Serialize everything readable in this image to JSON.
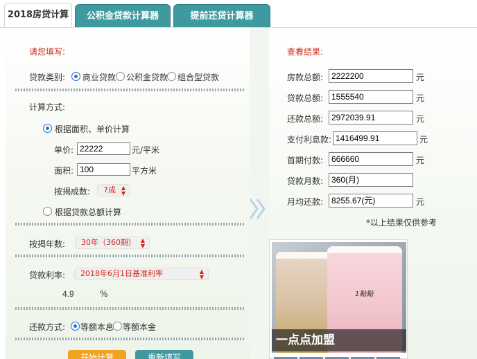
{
  "tabs": [
    "2018房贷计算器",
    "公积金贷款计算器",
    "提前还贷计算器"
  ],
  "form": {
    "header": "请您填写:",
    "loan_type_label": "贷款类别:",
    "loan_types": [
      "商业贷款",
      "公积金贷款",
      "组合型贷款"
    ],
    "calc_method_label": "计算方式:",
    "method_area": "根据面积、单价计算",
    "price_label": "单价:",
    "price_value": "22222",
    "price_unit": "元/平米",
    "area_label": "面积:",
    "area_value": "100",
    "area_unit": "平方米",
    "ratio_label": "按揭成数:",
    "ratio_value": "7成",
    "method_total": "根据贷款总额计算",
    "years_label": "按揭年数:",
    "years_value": "30年（360期）",
    "rate_label": "贷款利率:",
    "rate_value": "2018年6月1日基准利率",
    "rate_number": "4.9",
    "rate_unit": "%",
    "repay_label": "还款方式:",
    "repay_options": [
      "等额本息",
      "等额本金"
    ],
    "start_button": "开始计算",
    "reset_button": "重新填写"
  },
  "results": {
    "header": "查看结果:",
    "rows": [
      {
        "label": "房款总额:",
        "value": "2222200",
        "unit": "元"
      },
      {
        "label": "贷款总额:",
        "value": "1555540",
        "unit": "元"
      },
      {
        "label": "还款总额:",
        "value": "2972039.91",
        "unit": "元"
      },
      {
        "label": "支付利息款:",
        "value": "1416499.91",
        "unit": "元"
      },
      {
        "label": "首期付款:",
        "value": "666660",
        "unit": "元"
      },
      {
        "label": "贷款月数:",
        "value": "360(月)",
        "unit": ""
      },
      {
        "label": "月均还款:",
        "value": "8255.67(元)",
        "unit": "元"
      }
    ],
    "note": "*以上结果仅供参考"
  },
  "ad": {
    "caption": "一点点加盟",
    "brand": "1點點"
  },
  "colors": {
    "accent_red": "#d2291e",
    "tab_teal": "#3f9aa0",
    "button_orange": "#f0a321"
  }
}
